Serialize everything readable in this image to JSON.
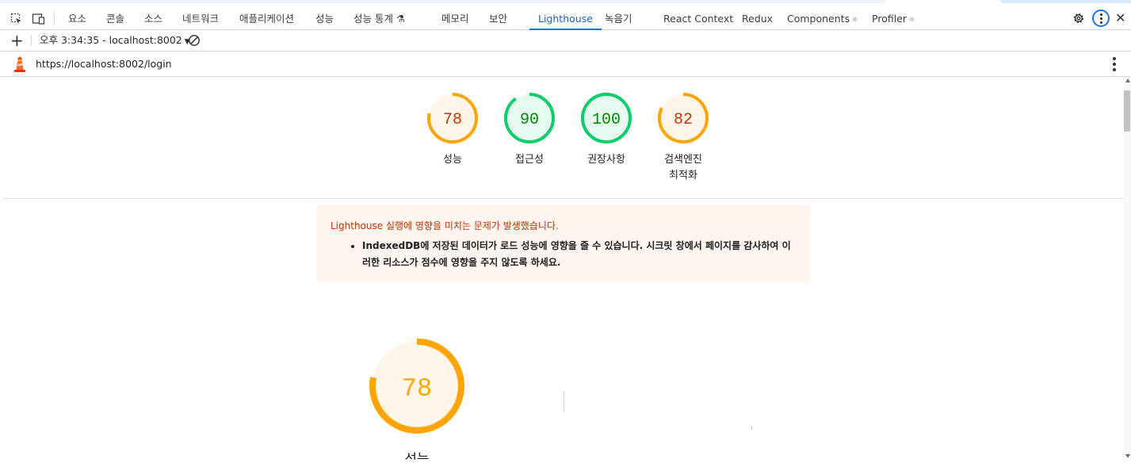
{
  "devtools": {
    "tabs": [
      {
        "label": "요소"
      },
      {
        "label": "콘솔"
      },
      {
        "label": "소스"
      },
      {
        "label": "네트워크"
      },
      {
        "label": "애플리케이션"
      },
      {
        "label": "성능"
      },
      {
        "label": "성능 통계 ⚗"
      },
      {
        "label": "메모리"
      },
      {
        "label": "보안"
      },
      {
        "label": "Lighthouse",
        "active": true
      },
      {
        "label": "녹음기"
      },
      {
        "label": "React Context"
      },
      {
        "label": "Redux"
      },
      {
        "label": "Components"
      },
      {
        "label": "Profiler"
      }
    ],
    "right_icons": [
      "gear-icon",
      "more-vert-icon",
      "close-icon"
    ]
  },
  "toolbar": {
    "report_selector": "오후 3:34:35 - localhost:8002"
  },
  "report": {
    "url": "https://localhost:8002/login",
    "scores": [
      {
        "label": "성능",
        "value": 78,
        "rating": "average"
      },
      {
        "label": "접근성",
        "value": 90,
        "rating": "pass"
      },
      {
        "label": "권장사항",
        "value": 100,
        "rating": "pass"
      },
      {
        "label": "검색엔진\n최적화",
        "value": 82,
        "rating": "average"
      }
    ],
    "warning": {
      "title": "Lighthouse 실행에 영향을 미치는 문제가 발생했습니다.",
      "items": [
        "IndexedDB에 저장된 데이터가 로드 성능에 영향을 줄 수 있습니다. 시크릿 창에서 페이지를 감사하여 이러한 리소스가 점수에 영향을 주지 않도록 하세요."
      ]
    },
    "main_score": {
      "label": "성능",
      "value": 78
    }
  },
  "colors": {
    "average": "#ffa400",
    "average_fill": "#fff5e8",
    "average_text": "#c33300",
    "pass": "#0cce6b",
    "pass_fill": "#e6faef",
    "pass_text": "#008800",
    "accent": "#1a73e8"
  }
}
